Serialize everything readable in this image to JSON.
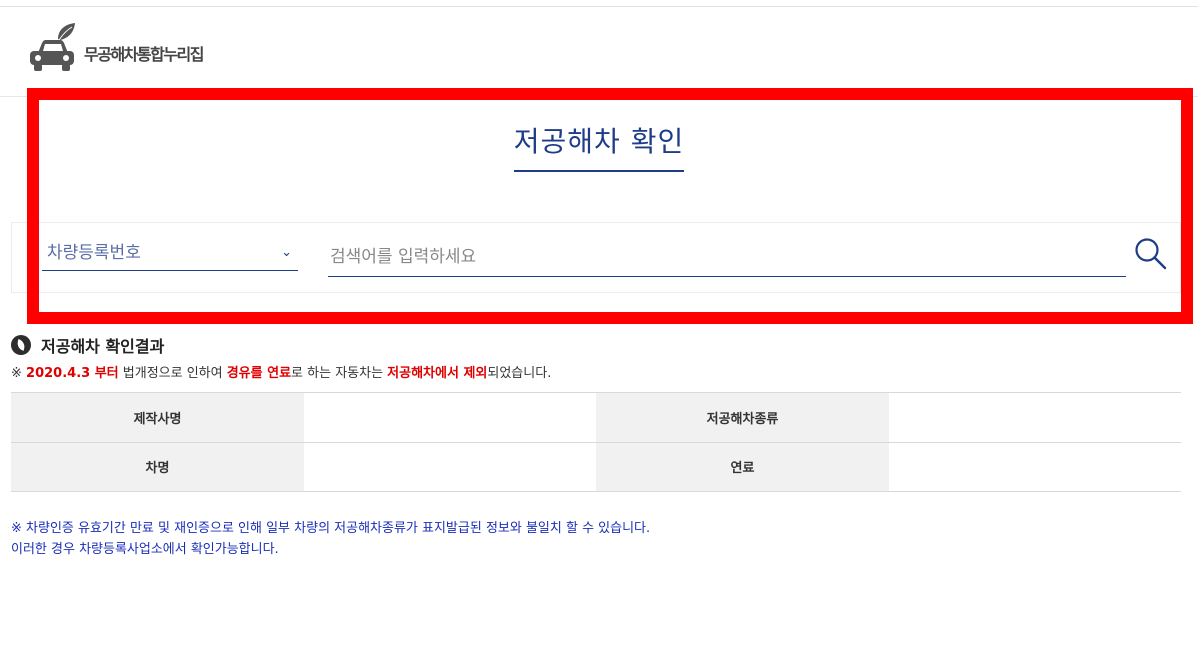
{
  "header": {
    "logo_text": "무공해차통합누리집",
    "logo_icon": "car-with-leaf-icon"
  },
  "search": {
    "title": "저공해차 확인",
    "select_value": "차량등록번호",
    "select_chevron": "⌄",
    "input_placeholder": "검색어를 입력하세요",
    "search_icon": "search-icon"
  },
  "result": {
    "title": "저공해차 확인결과",
    "notice": {
      "mark": "※ ",
      "date": "2020.4.3 부터",
      "part1": " 법개정으로 인하여 ",
      "fuel": "경유를 연료",
      "part2": "로 하는 자동차는 ",
      "excluded": "저공해차에서 제외",
      "part3": "되었습니다."
    },
    "table": {
      "row1": {
        "label1": "제작사명",
        "value1": "",
        "label2": "저공해차종류",
        "value2": ""
      },
      "row2": {
        "label1": "차명",
        "value1": "",
        "label2": "연료",
        "value2": ""
      }
    }
  },
  "footnote": {
    "line1": "※ 차량인증 유효기간 만료 및 재인증으로 인해 일부 차량의 저공해차종류가 표지발급된 정보와 불일치 할 수 있습니다.",
    "line2": "이러한 경우 차량등록사업소에서 확인가능합니다."
  },
  "colors": {
    "accent": "#1f3c88",
    "highlight_box": "#ff0000",
    "notice_red": "#e00000",
    "footnote_blue": "#1a2fb8"
  }
}
